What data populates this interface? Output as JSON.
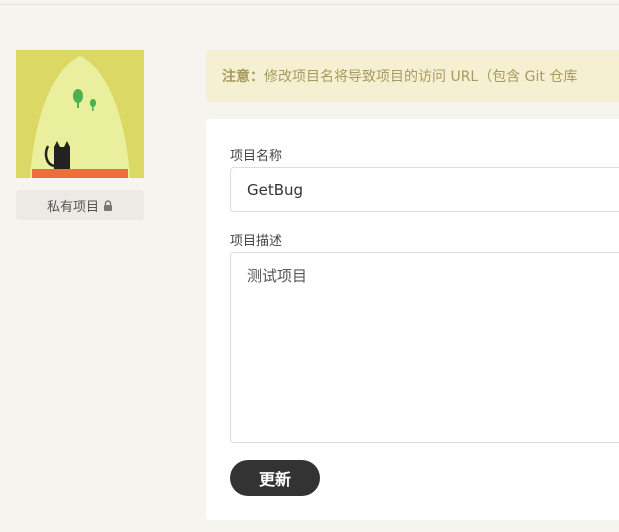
{
  "project": {
    "visibility_label": "私有项目",
    "visibility_icon": "lock-icon"
  },
  "notice": {
    "label": "注意：",
    "text": "修改项目名将导致项目的访问 URL（包含 Git 仓库"
  },
  "form": {
    "name_label": "项目名称",
    "name_value": "GetBug",
    "description_label": "项目描述",
    "description_value": "测试项目",
    "submit_label": "更新"
  },
  "colors": {
    "page_bg": "#f5f4ef",
    "notice_bg": "#f6f0d3",
    "notice_text": "#a69a5c",
    "button_bg": "#333333",
    "cover_bg": "#e9ef9c",
    "cover_curtain": "#dcd865",
    "cover_floor": "#f26b3a"
  }
}
